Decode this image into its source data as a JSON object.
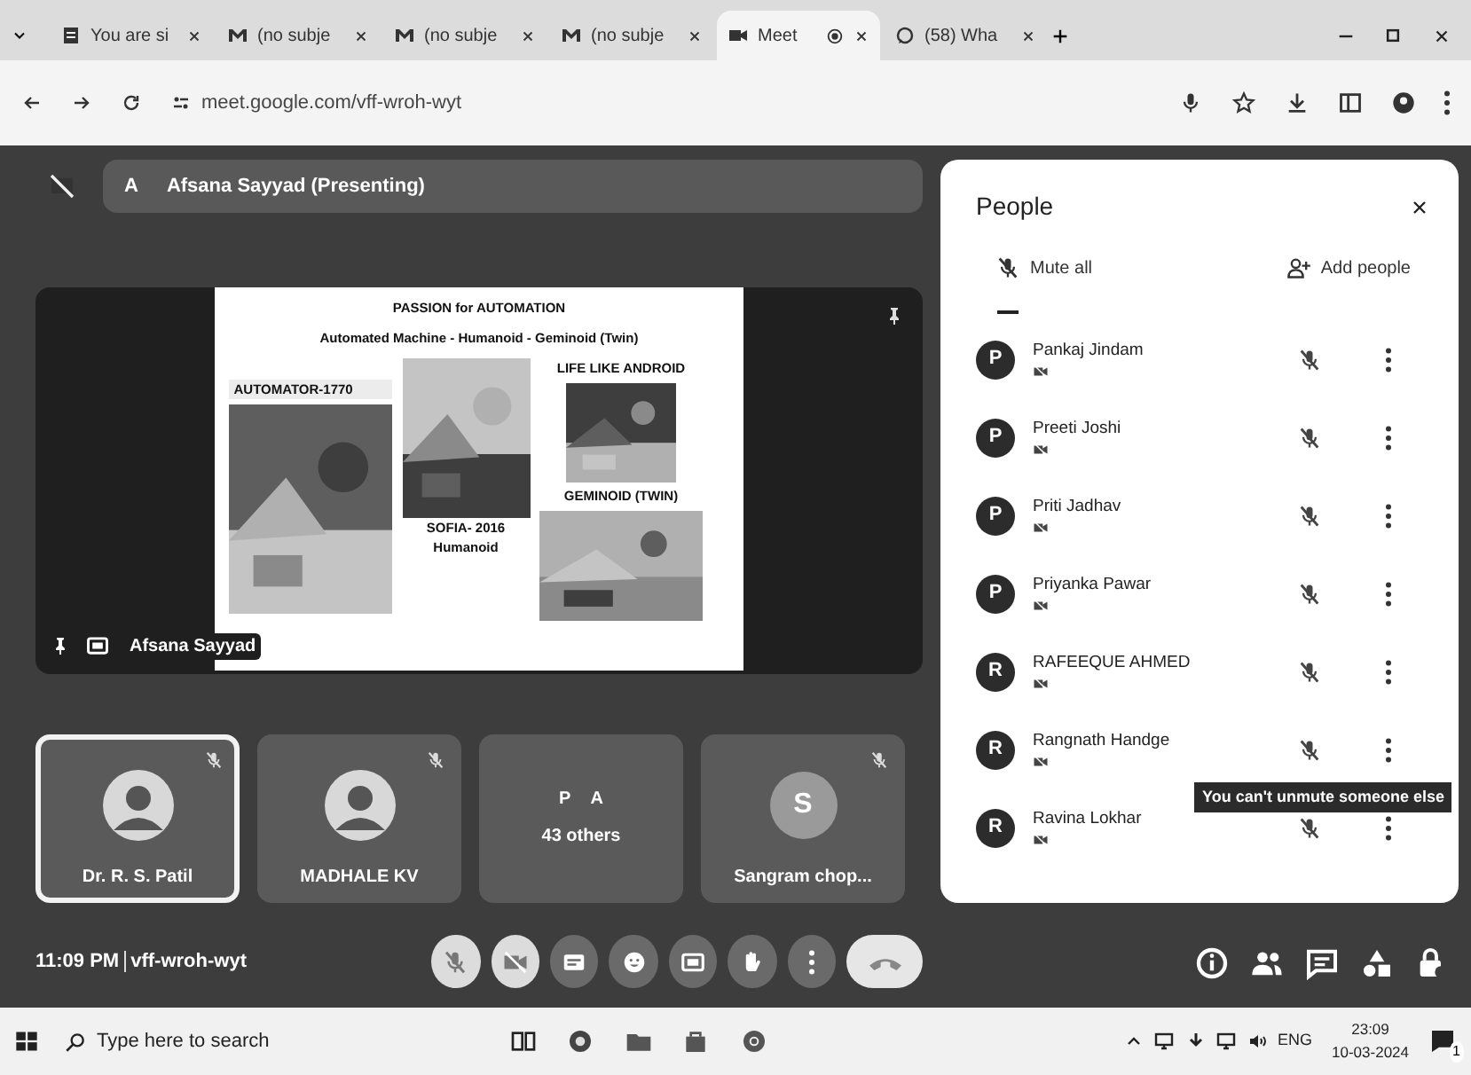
{
  "browser": {
    "tabs": [
      {
        "kind": "doc",
        "title": "You are si",
        "selected": false
      },
      {
        "kind": "mail",
        "title": "(no subje",
        "selected": false
      },
      {
        "kind": "mail",
        "title": "(no subje",
        "selected": false
      },
      {
        "kind": "mail",
        "title": "(no subje",
        "selected": false
      },
      {
        "kind": "meet",
        "title": "Meet",
        "selected": true
      },
      {
        "kind": "chat",
        "title": "(58) Wha",
        "selected": false
      }
    ],
    "url": "meet.google.com/vff-wroh-wyt"
  },
  "meet": {
    "banner": {
      "initial": "A",
      "text": "Afsana Sayyad (Presenting)"
    },
    "presenter_name": "Afsana Sayyad",
    "slide": {
      "title": "PASSION for AUTOMATION",
      "subtitle": "Automated Machine  - Humanoid -  Geminoid (Twin)",
      "left_label": "AUTOMATOR-1770",
      "mid_caption": [
        "SOFIA- 2016",
        "Humanoid"
      ],
      "right_label": "LIFE LIKE ANDROID",
      "right_caption": "GEMINOID (TWIN)"
    },
    "tiles": [
      {
        "kind": "avatar",
        "name": "Dr. R. S. Patil",
        "selected": true
      },
      {
        "kind": "avatar",
        "name": "MADHALE KV",
        "selected": false
      },
      {
        "kind": "group",
        "initials": [
          "P",
          "A"
        ],
        "name": "43 others",
        "selected": false
      },
      {
        "kind": "letter",
        "initial": "S",
        "name": "Sangram chop...",
        "selected": false
      }
    ],
    "clock": "11:09 PM",
    "meeting_code": "vff-wroh-wyt"
  },
  "people": {
    "title": "People",
    "mute_all": "Mute all",
    "add": "Add people",
    "participants": [
      {
        "initial": "P",
        "name": "Pankaj Jindam"
      },
      {
        "initial": "P",
        "name": "Preeti Joshi"
      },
      {
        "initial": "P",
        "name": "Priti Jadhav"
      },
      {
        "initial": "P",
        "name": "Priyanka Pawar"
      },
      {
        "initial": "R",
        "name": "RAFEEQUE AHMED"
      },
      {
        "initial": "R",
        "name": "Rangnath Handge"
      },
      {
        "initial": "R",
        "name": "Ravina Lokhar"
      }
    ],
    "tooltip": "You can't unmute someone else"
  },
  "taskbar": {
    "search_placeholder": "Type here to search",
    "language": "ENG",
    "time": "23:09",
    "date": "10-03-2024",
    "notifications": "1"
  }
}
